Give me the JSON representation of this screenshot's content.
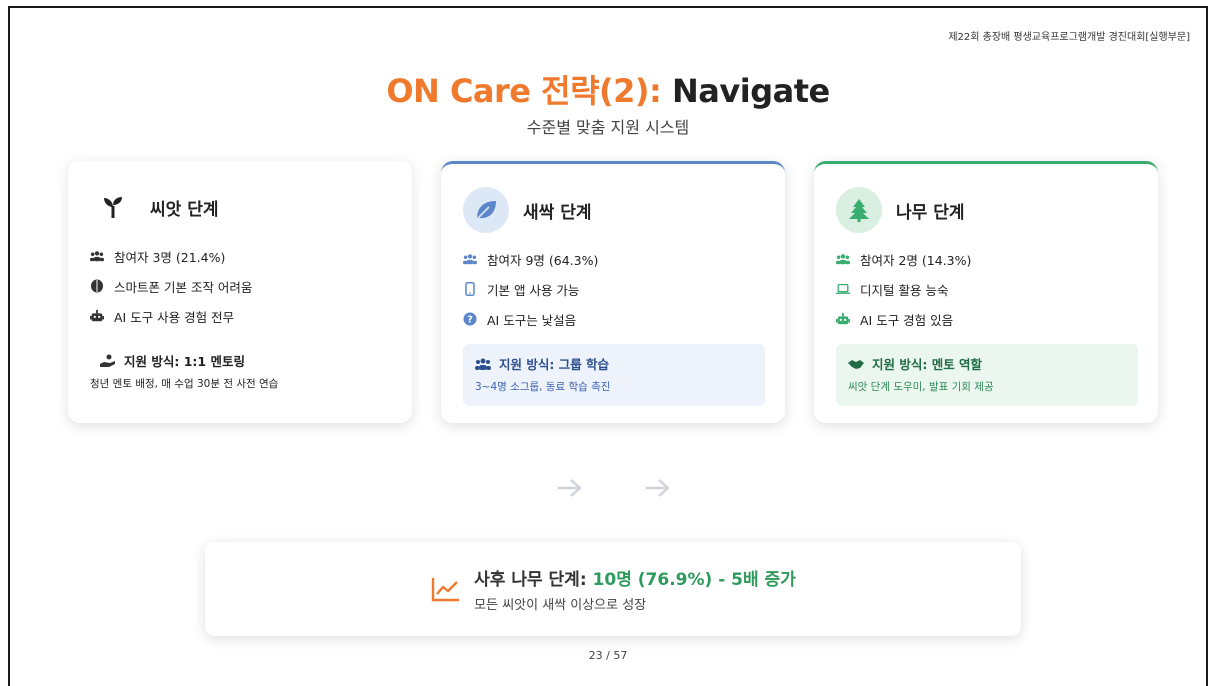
{
  "header_note": "제22회 총장배 평생교육프로그램개발 경진대회[실행부문]",
  "title": {
    "accent": "ON Care 전략(2):",
    "rest": " Navigate"
  },
  "subtitle": "수준별 맞춤 지원 시스템",
  "colors": {
    "accent_orange": "#ef7a2e",
    "blue": "#5b86c9",
    "green": "#39ad6f"
  },
  "cards": [
    {
      "title": "씨앗 단계",
      "icon": "seedling-icon",
      "rows": [
        {
          "icon": "users-icon",
          "text": "참여자 3명 (21.4%)"
        },
        {
          "icon": "brain-icon",
          "text": "스마트폰 기본 조작 어려움"
        },
        {
          "icon": "robot-icon",
          "text": "AI 도구 사용 경험 전무"
        }
      ],
      "support_title": "지원 방식: 1:1 멘토링",
      "support_icon": "hand-holding-icon",
      "support_desc": "청년 멘토 배정, 매 수업 30분 전 사전 연습"
    },
    {
      "title": "새싹 단계",
      "icon": "leaf-icon",
      "rows": [
        {
          "icon": "users-icon",
          "text": "참여자 9명 (64.3%)"
        },
        {
          "icon": "mobile-icon",
          "text": "기본 앱 사용 가능"
        },
        {
          "icon": "question-circle-icon",
          "text": "AI 도구는 낯설음"
        }
      ],
      "support_title": "지원 방식: 그룹 학습",
      "support_icon": "group-icon",
      "support_desc": "3~4명 소그룹, 동료 학습 촉진"
    },
    {
      "title": "나무 단계",
      "icon": "tree-icon",
      "rows": [
        {
          "icon": "users-icon",
          "text": "참여자 2명 (14.3%)"
        },
        {
          "icon": "laptop-icon",
          "text": "디지털 활용 능숙"
        },
        {
          "icon": "robot-icon",
          "text": "AI 도구 경험 있음"
        }
      ],
      "support_title": "지원 방식: 멘토 역할",
      "support_icon": "handshake-icon",
      "support_desc": "씨앗 단계 도우미, 발표 기회 제공"
    }
  ],
  "summary": {
    "icon": "chart-line-icon",
    "label": "사후 나무 단계: ",
    "highlight": "10명 (76.9%) - 5배 증가",
    "sub": "모든 씨앗이 새싹 이상으로 성장"
  },
  "page_number": "23 / 57"
}
